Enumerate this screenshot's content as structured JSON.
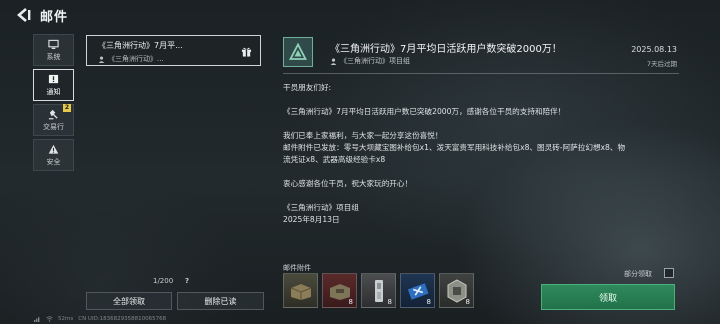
{
  "header": {
    "title": "邮件"
  },
  "tabs": [
    {
      "label": "系统",
      "icon": "monitor-icon"
    },
    {
      "label": "通知",
      "icon": "exclamation-icon"
    },
    {
      "label": "交易行",
      "icon": "hammer-icon",
      "badge": "2"
    },
    {
      "label": "安全",
      "icon": "warning-icon"
    }
  ],
  "mail_list": {
    "items": [
      {
        "title": "《三角洲行动》7月平...",
        "sender": "《三角洲行动》..."
      }
    ],
    "count": "1/200",
    "help": "?"
  },
  "actions": {
    "claim_all": "全部领取",
    "delete_read": "删除已读"
  },
  "status": {
    "ping": "52ms",
    "uid": "CN UID:1836829358810065768"
  },
  "mail": {
    "title": "《三角洲行动》7月平均日活跃用户数突破2000万！",
    "sender": "《三角洲行动》项目组",
    "date": "2025.08.13",
    "expire": "7天后过期",
    "greeting": "干员朋友们好:",
    "para1": "《三角洲行动》7月平均日活跃用户数已突破2000万，感谢各位干员的支持和陪伴！",
    "para2_line1": "我们已奉上家福利，与大家一起分享这份喜悦！",
    "para2_line2": "邮件附件已发放：零号大坝藏宝图补给包x1、泼天富贵军用科技补给包x8、图灵砖-阿萨拉幻想x8、物",
    "para2_line3": "流凭证x8、武器高级经验卡x8",
    "para3": "衷心感谢各位干员，祝大家玩的开心！",
    "sign": "《三角洲行动》项目组",
    "sign_date": "2025年8月13日"
  },
  "attachments": {
    "label": "邮件附件",
    "items": [
      {
        "icon": "treasure-map-pack-icon",
        "count": ""
      },
      {
        "icon": "military-supply-pack-icon",
        "count": "8"
      },
      {
        "icon": "turing-brick-icon",
        "count": "8"
      },
      {
        "icon": "logistics-voucher-icon",
        "count": "8"
      },
      {
        "icon": "weapon-exp-card-icon",
        "count": "8"
      }
    ]
  },
  "partial_claim_label": "部分领取",
  "claim_button": "领取",
  "colors": {
    "accent_green": "#2f8a5c",
    "badge_yellow": "#e7c84a",
    "logo_teal": "#6fae9a"
  }
}
